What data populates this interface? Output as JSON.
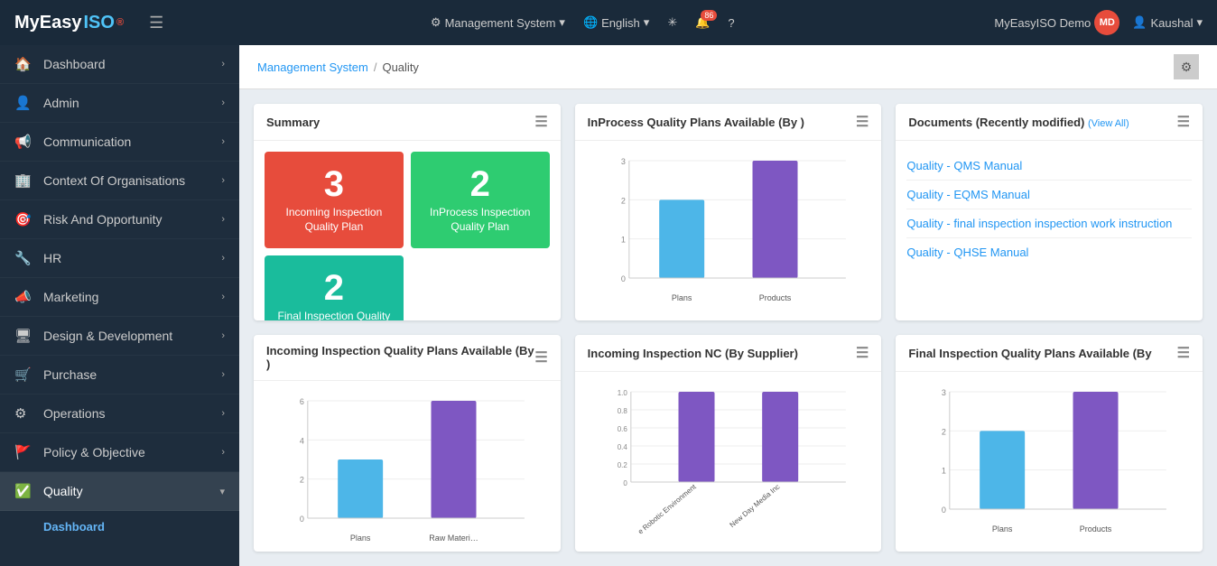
{
  "brand": {
    "name_part1": "MyEasy",
    "name_part2": "ISO",
    "sup": "®"
  },
  "topnav": {
    "management_system": "Management System",
    "language": "English",
    "notification_count": "86",
    "help": "?",
    "demo_label": "MyEasyISO Demo",
    "user": "Kaushal"
  },
  "breadcrumb": {
    "root": "Management System",
    "separator": "/",
    "current": "Quality"
  },
  "sidebar": {
    "items": [
      {
        "id": "dashboard",
        "icon": "🏠",
        "label": "Dashboard",
        "has_chevron": true
      },
      {
        "id": "admin",
        "icon": "👤",
        "label": "Admin",
        "has_chevron": true
      },
      {
        "id": "communication",
        "icon": "📢",
        "label": "Communication",
        "has_chevron": true
      },
      {
        "id": "context",
        "icon": "🏢",
        "label": "Context Of Organisations",
        "has_chevron": true
      },
      {
        "id": "risk",
        "icon": "🎯",
        "label": "Risk And Opportunity",
        "has_chevron": true
      },
      {
        "id": "hr",
        "icon": "🔧",
        "label": "HR",
        "has_chevron": true
      },
      {
        "id": "marketing",
        "icon": "📣",
        "label": "Marketing",
        "has_chevron": true
      },
      {
        "id": "design",
        "icon": "🖥",
        "label": "Design & Development",
        "has_chevron": true
      },
      {
        "id": "purchase",
        "icon": "🛒",
        "label": "Purchase",
        "has_chevron": true
      },
      {
        "id": "operations",
        "icon": "⚙",
        "label": "Operations",
        "has_chevron": true
      },
      {
        "id": "policy",
        "icon": "🚩",
        "label": "Policy & Objective",
        "has_chevron": true
      },
      {
        "id": "quality",
        "icon": "✅",
        "label": "Quality",
        "has_chevron": true,
        "active": true
      }
    ],
    "sub_items": [
      {
        "id": "quality-dashboard",
        "label": "Dashboard",
        "active": true
      }
    ]
  },
  "cards": {
    "summary": {
      "title": "Summary",
      "tiles": [
        {
          "count": "3",
          "label": "Incoming Inspection Quality Plan",
          "color": "red"
        },
        {
          "count": "2",
          "label": "InProcess Inspection Quality Plan",
          "color": "green"
        },
        {
          "count": "2",
          "label": "Final Inspection Quality Plan",
          "color": "teal"
        }
      ]
    },
    "inprocess": {
      "title": "InProcess Quality Plans Available (By )",
      "chart": {
        "bars": [
          {
            "label": "Plans",
            "value": 2,
            "color": "#4db6e8"
          },
          {
            "label": "Products",
            "value": 3,
            "color": "#7e57c2"
          }
        ],
        "max": 3,
        "y_labels": [
          "0",
          "1",
          "2",
          "3"
        ]
      }
    },
    "documents": {
      "title": "Documents (Recently modified)",
      "view_all": "(View All)",
      "items": [
        "Quality - QMS Manual",
        "Quality - EQMS Manual",
        "Quality - final inspection inspection work instruction",
        "Quality - QHSE Manual"
      ]
    },
    "incoming_plans": {
      "title": "Incoming Inspection Quality Plans Available (By )",
      "chart": {
        "bars": [
          {
            "label": "Plans",
            "value": 3,
            "color": "#4db6e8"
          },
          {
            "label": "Raw Materials",
            "value": 6,
            "color": "#7e57c2"
          }
        ],
        "max": 6,
        "y_labels": [
          "0",
          "2",
          "4",
          "6"
        ]
      }
    },
    "incoming_nc": {
      "title": "Incoming Inspection NC (By Supplier)",
      "chart": {
        "bars": [
          {
            "label": "e Robotic Environment",
            "value": 1.0,
            "color": "#7e57c2"
          },
          {
            "label": "New Day Media Inc",
            "value": 1.0,
            "color": "#7e57c2"
          }
        ],
        "max": 1.0,
        "y_labels": [
          "0",
          "0.2",
          "0.4",
          "0.6",
          "0.8",
          "1.0"
        ]
      }
    },
    "final_plans": {
      "title": "Final Inspection Quality Plans Available (By",
      "chart": {
        "bars": [
          {
            "label": "Plans",
            "value": 2,
            "color": "#4db6e8"
          },
          {
            "label": "Products",
            "value": 3,
            "color": "#7e57c2"
          }
        ],
        "max": 3,
        "y_labels": [
          "0",
          "1",
          "2",
          "3"
        ]
      }
    }
  }
}
